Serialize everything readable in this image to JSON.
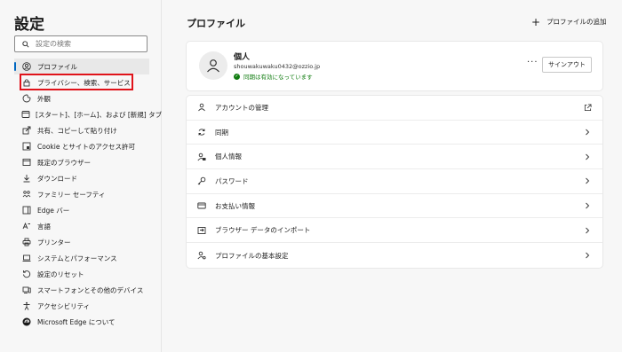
{
  "sidebar": {
    "title": "設定",
    "search_placeholder": "設定の検索",
    "items": [
      {
        "label": "プロファイル",
        "icon": "profile-icon"
      },
      {
        "label": "プライバシー、検索、サービス",
        "icon": "lock-icon"
      },
      {
        "label": "外観",
        "icon": "appearance-icon"
      },
      {
        "label": "[スタート]、[ホーム]、および [新規] タブ",
        "icon": "home-tab-icon"
      },
      {
        "label": "共有、コピーして貼り付け",
        "icon": "share-icon"
      },
      {
        "label": "Cookie とサイトのアクセス許可",
        "icon": "cookie-site-icon"
      },
      {
        "label": "既定のブラウザー",
        "icon": "browser-icon"
      },
      {
        "label": "ダウンロード",
        "icon": "download-icon"
      },
      {
        "label": "ファミリー セーフティ",
        "icon": "family-icon"
      },
      {
        "label": "Edge バー",
        "icon": "edge-bar-icon"
      },
      {
        "label": "言語",
        "icon": "language-icon"
      },
      {
        "label": "プリンター",
        "icon": "printer-icon"
      },
      {
        "label": "システムとパフォーマンス",
        "icon": "system-icon"
      },
      {
        "label": "設定のリセット",
        "icon": "reset-icon"
      },
      {
        "label": "スマートフォンとその他のデバイス",
        "icon": "phone-icon"
      },
      {
        "label": "アクセシビリティ",
        "icon": "accessibility-icon"
      },
      {
        "label": "Microsoft Edge について",
        "icon": "edge-logo-icon"
      }
    ]
  },
  "main": {
    "title": "プロファイル",
    "add_profile": "プロファイルの追加",
    "profile": {
      "name": "個人",
      "email": "shouwakuwaku0432@ozzio.jp",
      "sync_status": "同期は有効になっています",
      "more": "···",
      "signout": "サインアウト"
    },
    "rows": [
      {
        "label": "アカウントの管理",
        "icon": "account-icon",
        "trail": "external-link-icon"
      },
      {
        "label": "同期",
        "icon": "sync-icon",
        "trail": "chevron-right-icon"
      },
      {
        "label": "個人情報",
        "icon": "personal-info-icon",
        "trail": "chevron-right-icon"
      },
      {
        "label": "パスワード",
        "icon": "key-icon",
        "trail": "chevron-right-icon"
      },
      {
        "label": "お支払い情報",
        "icon": "card-icon",
        "trail": "chevron-right-icon"
      },
      {
        "label": "ブラウザー データのインポート",
        "icon": "import-icon",
        "trail": "chevron-right-icon"
      },
      {
        "label": "プロファイルの基本設定",
        "icon": "profile-settings-icon",
        "trail": "chevron-right-icon"
      }
    ]
  },
  "colors": {
    "accent": "#0067c0",
    "highlight": "#e0131a",
    "sync_green": "#107c10"
  }
}
